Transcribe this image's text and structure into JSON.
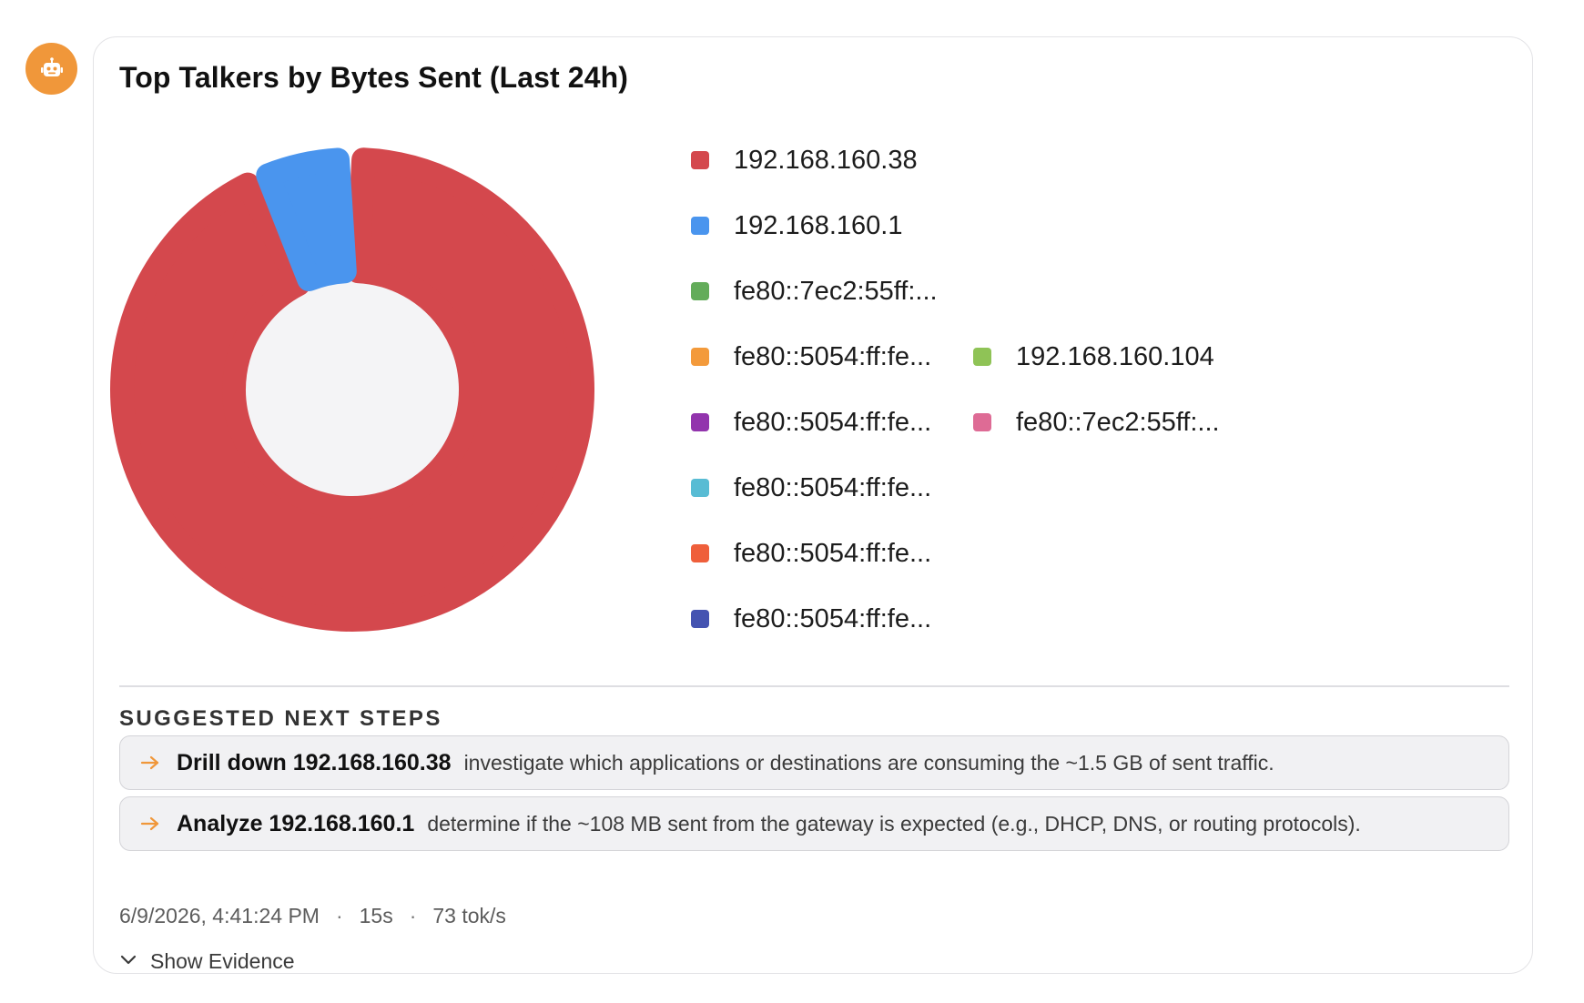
{
  "card": {
    "title": "Top Talkers by Bytes Sent (Last 24h)"
  },
  "chart_data": {
    "type": "pie",
    "donut": true,
    "title": "Top Talkers by Bytes Sent (Last 24h)",
    "legend_position": "right",
    "slices": [
      {
        "label": "192.168.160.38",
        "value": 93.3,
        "color": "#d4484d"
      },
      {
        "label": "192.168.160.1",
        "value": 6.5,
        "color": "#4a95ee"
      },
      {
        "label": "fe80::7ec2:55ff:...",
        "value": 0.03,
        "color": "#63ac5a"
      },
      {
        "label": "fe80::5054:ff:fe...",
        "value": 0.03,
        "color": "#f39a3b"
      },
      {
        "label": "192.168.160.104",
        "value": 0.03,
        "color": "#8fc356"
      },
      {
        "label": "fe80::5054:ff:fe...",
        "value": 0.03,
        "color": "#9234ad"
      },
      {
        "label": "fe80::7ec2:55ff:...",
        "value": 0.03,
        "color": "#de6b95"
      },
      {
        "label": "fe80::5054:ff:fe...",
        "value": 0.03,
        "color": "#58bcd4"
      },
      {
        "label": "fe80::5054:ff:fe...",
        "value": 0.03,
        "color": "#ef5f3b"
      },
      {
        "label": "fe80::5054:ff:fe...",
        "value": 0.03,
        "color": "#4453b1"
      }
    ]
  },
  "suggestions": {
    "heading": "SUGGESTED NEXT STEPS",
    "items": [
      {
        "title": "Drill down 192.168.160.38",
        "description": "investigate which applications or destinations are consuming the ~1.5 GB of sent traffic."
      },
      {
        "title": "Analyze 192.168.160.1",
        "description": "determine if the ~108 MB sent from the gateway is expected (e.g., DHCP, DNS, or routing protocols)."
      }
    ]
  },
  "meta": {
    "timestamp": "6/9/2026, 4:41:24 PM",
    "duration": "15s",
    "speed": "73 tok/s",
    "separator": "·"
  },
  "evidence": {
    "label": "Show Evidence"
  },
  "icons": {
    "avatar": "robot-icon",
    "step": "arrow-right-icon",
    "evidence": "chevron-down-icon"
  },
  "colors": {
    "accent": "#f0973a",
    "card_border": "#e3e3e6",
    "donut_hole": "#f4f4f6"
  }
}
